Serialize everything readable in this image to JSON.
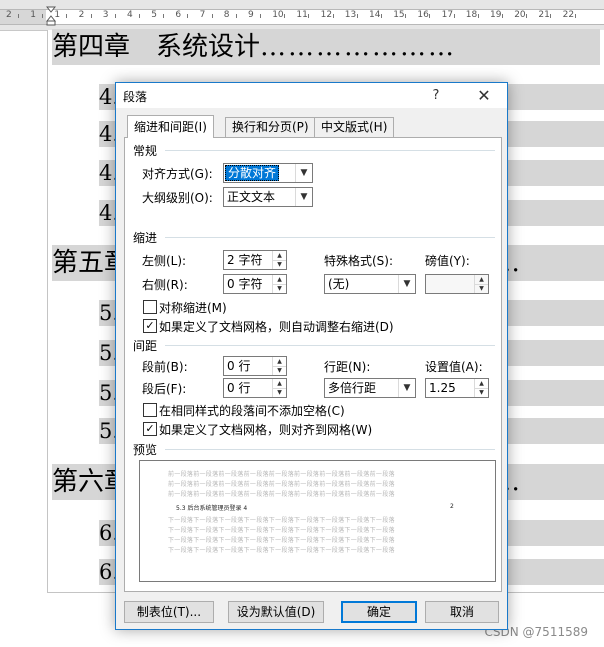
{
  "ruler": {
    "numbers": [
      "2",
      "1",
      "1",
      "2",
      "3",
      "4",
      "5",
      "6",
      "7",
      "8",
      "9",
      "10",
      "11",
      "12",
      "13",
      "14",
      "15",
      "16",
      "17",
      "18",
      "19",
      "20",
      "21",
      "22"
    ]
  },
  "document": {
    "chapter4": {
      "title": "第四章　系统设计",
      "dots": "…………………"
    },
    "chapter5": {
      "title": "第五章",
      "dots": "……………………………………"
    },
    "chapter6": {
      "title": "第六章",
      "dots": "……………………………………"
    },
    "section_prefix_4": "4.",
    "section_prefix_5": "5.",
    "section_prefix_6": "6.",
    "section_dots": "……………………………………"
  },
  "watermark": "CSDN @7511589",
  "dialog": {
    "title": "段落",
    "help": "?",
    "close": "✕",
    "tabs": [
      "缩进和间距(I)",
      "换行和分页(P)",
      "中文版式(H)"
    ],
    "general": {
      "heading": "常规",
      "alignment_label": "对齐方式(G):",
      "alignment_value": "分散对齐",
      "outline_label": "大纲级别(O):",
      "outline_value": "正文文本"
    },
    "indent": {
      "heading": "缩进",
      "left_label": "左侧(L):",
      "left_value": "2 字符",
      "right_label": "右侧(R):",
      "right_value": "0 字符",
      "special_label": "特殊格式(S):",
      "special_value": "(无)",
      "by_label": "磅值(Y):",
      "by_value": "",
      "mirror_label": "对称缩进(M)",
      "mirror_checked": false,
      "auto_label": "如果定义了文档网格，则自动调整右缩进(D)",
      "auto_checked": true
    },
    "spacing": {
      "heading": "间距",
      "before_label": "段前(B):",
      "before_value": "0 行",
      "after_label": "段后(F):",
      "after_value": "0 行",
      "line_label": "行距(N):",
      "line_value": "多倍行距",
      "at_label": "设置值(A):",
      "at_value": "1.25",
      "nospace_label": "在相同样式的段落间不添加空格(C)",
      "nospace_checked": false,
      "grid_label": "如果定义了文档网格，则对齐到网格(W)",
      "grid_checked": true
    },
    "preview": {
      "heading": "预览",
      "prev_text": "前一段落前一段落前一段落前一段落前一段落前一段落前一段落前一段落前一段落",
      "main_text": "5.3  后台系统管理员登录    4",
      "page_num": "2",
      "next_text": "下一段落下一段落下一段落下一段落下一段落下一段落下一段落下一段落下一段落"
    },
    "buttons": {
      "tabs": "制表位(T)...",
      "default": "设为默认值(D)",
      "ok": "确定",
      "cancel": "取消"
    }
  }
}
